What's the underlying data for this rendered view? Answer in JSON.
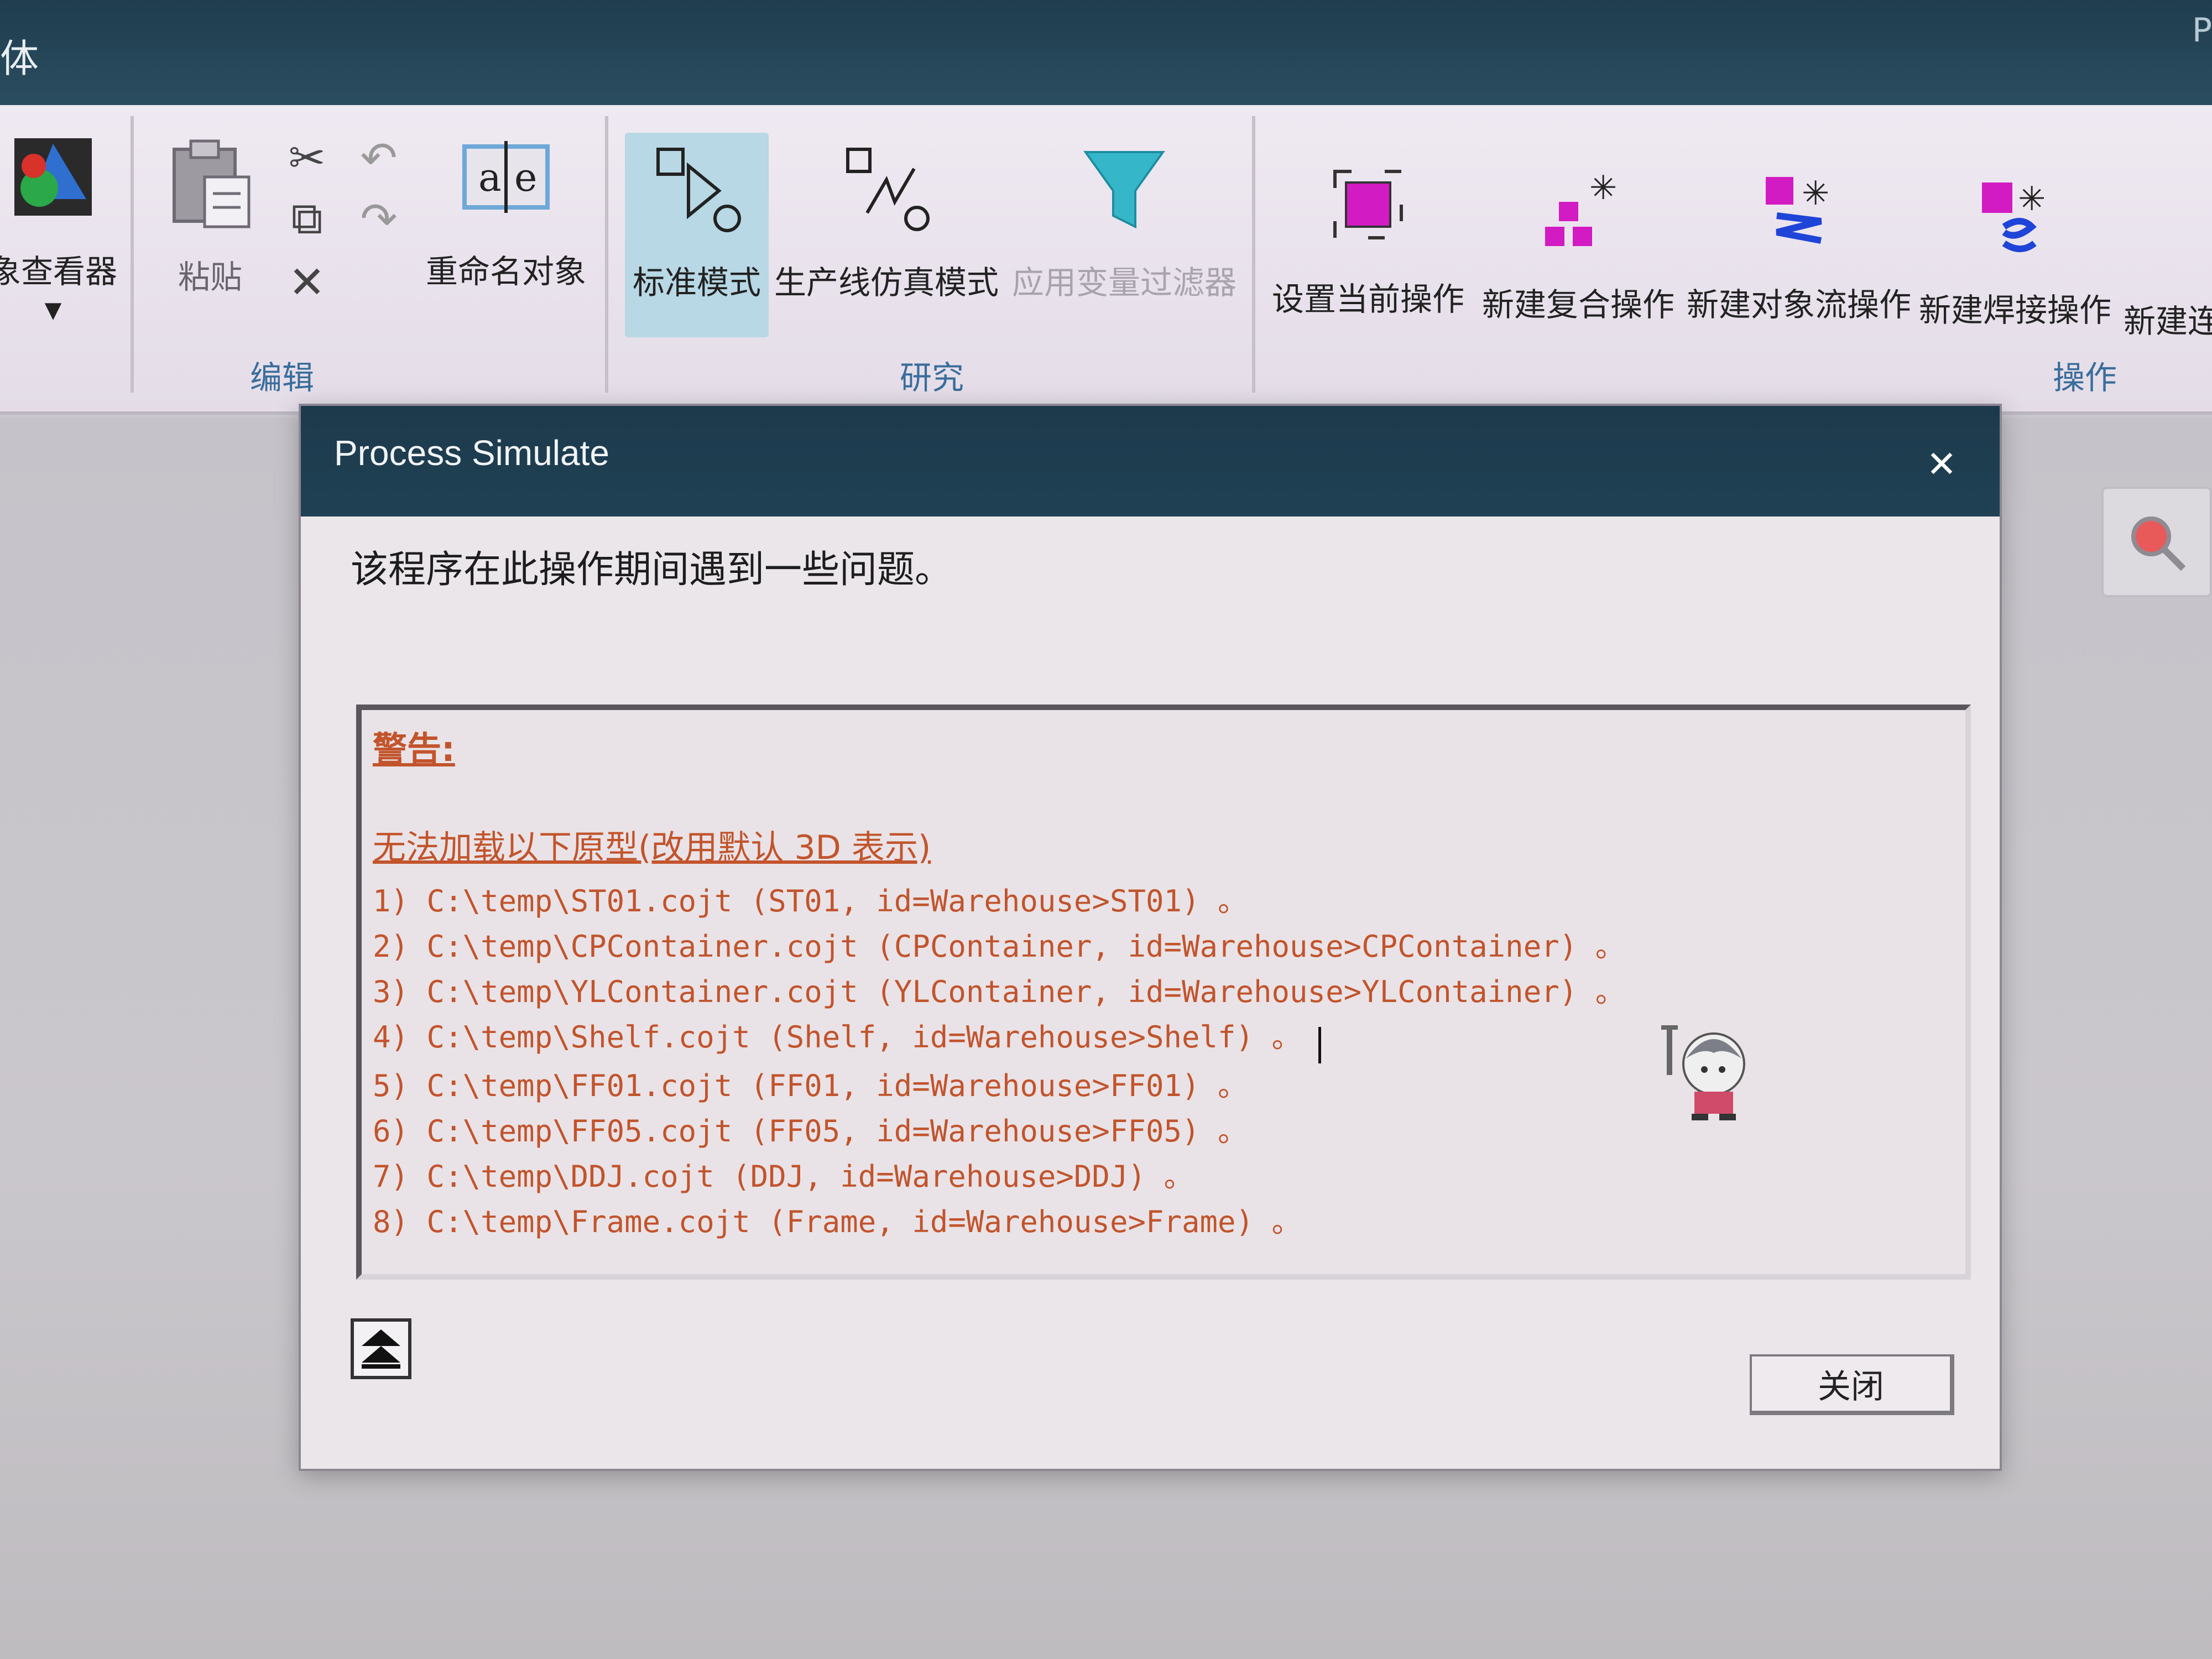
{
  "window": {
    "title_fragment": "体",
    "corner_letter": "P"
  },
  "ribbon": {
    "viewer_label": "象查看器",
    "edit": {
      "paste": "粘贴",
      "rename": "重命名对象",
      "group_label": "编辑"
    },
    "research": {
      "standard_mode": "标准模式",
      "line_sim_mode": "生产线仿真模式",
      "apply_variable_filter": "应用变量过滤器",
      "group_label": "研究"
    },
    "operation": {
      "set_current": "设置当前操作",
      "new_compound": "新建复合操作",
      "new_object_flow": "新建对象流操作",
      "new_weld": "新建焊接操作",
      "new_continuous": "新建连",
      "group_label": "操作"
    }
  },
  "dialog": {
    "title": "Process Simulate",
    "message": "该程序在此操作期间遇到一些问题。",
    "warning_title": "警告:",
    "warning_subtitle": "无法加载以下原型(改用默认 3D 表示)",
    "lines": [
      "1) C:\\temp\\ST01.cojt (ST01, id=Warehouse>ST01) 。",
      "2) C:\\temp\\CPContainer.cojt (CPContainer, id=Warehouse>CPContainer) 。",
      "3) C:\\temp\\YLContainer.cojt (YLContainer, id=Warehouse>YLContainer) 。",
      "4) C:\\temp\\Shelf.cojt (Shelf, id=Warehouse>Shelf) 。",
      "5) C:\\temp\\FF01.cojt (FF01, id=Warehouse>FF01) 。",
      "6) C:\\temp\\FF05.cojt (FF05, id=Warehouse>FF05) 。",
      "7) C:\\temp\\DDJ.cojt (DDJ, id=Warehouse>DDJ) 。",
      "8) C:\\temp\\Frame.cojt (Frame, id=Warehouse>Frame) 。"
    ],
    "close_label": "关闭"
  },
  "colors": {
    "warning_text": "#c2542c",
    "title_bar": "#1d3a4c",
    "active_button": "#b7d8e4"
  },
  "icons": {
    "viewer": "object-viewer-icon",
    "paste": "paste-icon",
    "cut": "scissors-icon",
    "copy": "copy-icon",
    "delete": "delete-x-icon",
    "undo": "undo-icon",
    "redo": "redo-icon",
    "rename": "rename-text-icon",
    "standard_mode": "standard-mode-icon",
    "line_sim": "line-simulation-icon",
    "filter": "funnel-filter-icon",
    "set_current": "set-current-operation-icon",
    "compound": "compound-operation-icon",
    "object_flow": "object-flow-icon",
    "weld": "weld-operation-icon",
    "search": "search-icon"
  }
}
